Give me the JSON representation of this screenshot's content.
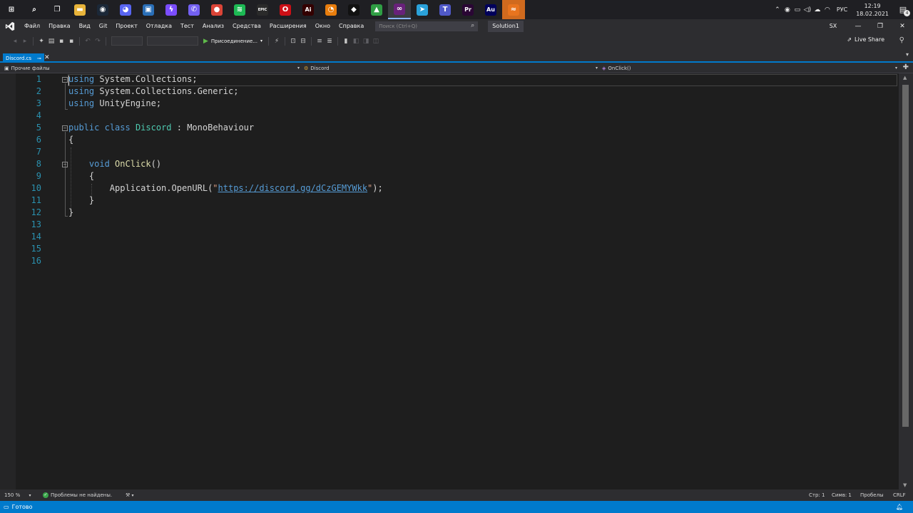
{
  "taskbar": {
    "apps": [
      {
        "name": "start",
        "label": "",
        "color": "transparent",
        "glyph": "⊞"
      },
      {
        "name": "search",
        "label": "",
        "color": "transparent",
        "glyph": "⌕"
      },
      {
        "name": "task-view",
        "label": "",
        "color": "transparent",
        "glyph": "❐"
      },
      {
        "name": "file-explorer",
        "label": "",
        "color": "#e8b43a",
        "glyph": "▬"
      },
      {
        "name": "steam",
        "label": "",
        "color": "#1b2838",
        "glyph": "◉"
      },
      {
        "name": "discord",
        "label": "",
        "color": "#5865f2",
        "glyph": "◕"
      },
      {
        "name": "remote-desktop",
        "label": "",
        "color": "#2a6fb8",
        "glyph": "▣"
      },
      {
        "name": "messenger",
        "label": "",
        "color": "#7b4dff",
        "glyph": "ϟ"
      },
      {
        "name": "viber",
        "label": "",
        "color": "#7360f2",
        "glyph": "✆"
      },
      {
        "name": "chrome",
        "label": "",
        "color": "#db4437",
        "glyph": "●"
      },
      {
        "name": "spotify",
        "label": "",
        "color": "#1db954",
        "glyph": "≋"
      },
      {
        "name": "epic-games",
        "label": "EPIC",
        "color": "#2a2a2a",
        "glyph": ""
      },
      {
        "name": "opera",
        "label": "",
        "color": "#cc0f16",
        "glyph": "O"
      },
      {
        "name": "illustrator",
        "label": "Ai",
        "color": "#330000",
        "glyph": ""
      },
      {
        "name": "blender",
        "label": "",
        "color": "#e87d0d",
        "glyph": "◔"
      },
      {
        "name": "nvidia",
        "label": "",
        "color": "#111111",
        "glyph": "◆"
      },
      {
        "name": "unity-hub",
        "label": "",
        "color": "#2f9e44",
        "glyph": "▲"
      },
      {
        "name": "visual-studio",
        "label": "",
        "color": "#68217a",
        "glyph": "∞"
      },
      {
        "name": "telegram",
        "label": "",
        "color": "#2aa1da",
        "glyph": "➤"
      },
      {
        "name": "teams",
        "label": "",
        "color": "#5059c9",
        "glyph": "T"
      },
      {
        "name": "premiere",
        "label": "Pr",
        "color": "#2a0634",
        "glyph": ""
      },
      {
        "name": "audition",
        "label": "Au",
        "color": "#00005b",
        "glyph": ""
      },
      {
        "name": "wunderlist",
        "label": "",
        "color": "#e8741e",
        "glyph": "≈"
      }
    ],
    "tray": {
      "language": "РУС",
      "time": "12:19",
      "date": "18.02.2021",
      "notifications": "4"
    }
  },
  "menubar": {
    "items": [
      "Файл",
      "Правка",
      "Вид",
      "Git",
      "Проект",
      "Отладка",
      "Тест",
      "Анализ",
      "Средства",
      "Расширения",
      "Окно",
      "Справка"
    ],
    "search_placeholder": "Поиск (Ctrl+Q)",
    "solution": "Solution1",
    "user_initials": "SX"
  },
  "toolbar": {
    "attach_label": "Присоединение...",
    "live_share": "Live Share"
  },
  "tabs": [
    {
      "label": "Discord.cs",
      "active": true
    }
  ],
  "navbar": {
    "project": "Прочие файлы",
    "class": "Discord",
    "member": "OnClick()"
  },
  "editor": {
    "line_numbers": [
      "1",
      "2",
      "3",
      "4",
      "5",
      "6",
      "7",
      "8",
      "9",
      "10",
      "11",
      "12",
      "13",
      "14",
      "15",
      "16"
    ],
    "lines": [
      [
        {
          "t": "using",
          "c": "kw"
        },
        {
          "t": " System.Collections;",
          "c": ""
        }
      ],
      [
        {
          "t": "using",
          "c": "kw"
        },
        {
          "t": " System.Collections.Generic;",
          "c": ""
        }
      ],
      [
        {
          "t": "using",
          "c": "kw"
        },
        {
          "t": " UnityEngine;",
          "c": ""
        }
      ],
      [],
      [
        {
          "t": "public",
          "c": "kw"
        },
        {
          "t": " ",
          "c": ""
        },
        {
          "t": "class",
          "c": "kw"
        },
        {
          "t": " ",
          "c": ""
        },
        {
          "t": "Discord",
          "c": "ty"
        },
        {
          "t": " : MonoBehaviour",
          "c": ""
        }
      ],
      [
        {
          "t": "{",
          "c": ""
        }
      ],
      [],
      [
        {
          "t": "    ",
          "c": ""
        },
        {
          "t": "void",
          "c": "kw"
        },
        {
          "t": " ",
          "c": ""
        },
        {
          "t": "OnClick",
          "c": "fn"
        },
        {
          "t": "()",
          "c": ""
        }
      ],
      [
        {
          "t": "    {",
          "c": ""
        }
      ],
      [
        {
          "t": "        Application.OpenURL(",
          "c": ""
        },
        {
          "t": "\"",
          "c": "st"
        },
        {
          "t": "https://discord.gg/dCzGEMYWkk",
          "c": "url"
        },
        {
          "t": "\"",
          "c": "st"
        },
        {
          "t": ");",
          "c": ""
        }
      ],
      [
        {
          "t": "    }",
          "c": ""
        }
      ],
      [
        {
          "t": "}",
          "c": ""
        }
      ],
      [],
      [],
      [],
      []
    ]
  },
  "editor_status": {
    "zoom": "150 %",
    "problems": "Проблемы не найдены.",
    "line": "Стр: 1",
    "column": "Симв: 1",
    "whitespace": "Пробелы",
    "line_ending": "CRLF"
  },
  "statusbar": {
    "ready": "Готово"
  }
}
